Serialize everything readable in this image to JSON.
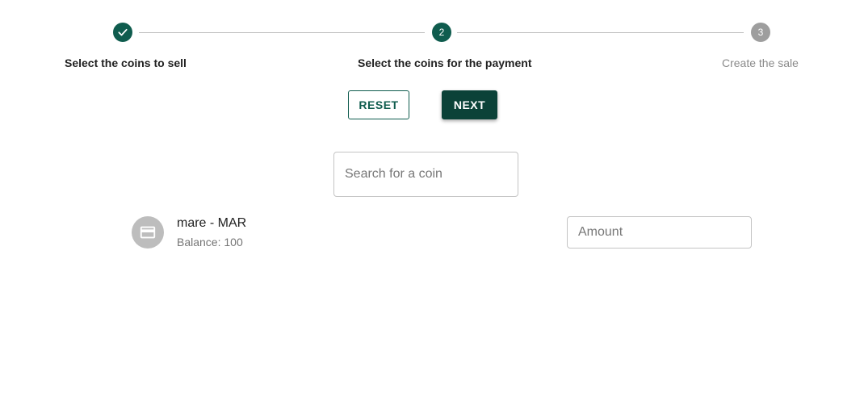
{
  "stepper": {
    "steps": [
      {
        "label": "Select the coins to sell",
        "state": "completed",
        "icon": "check-icon"
      },
      {
        "label": "Select the coins for the payment",
        "state": "active",
        "number": "2"
      },
      {
        "label": "Create the sale",
        "state": "pending",
        "number": "3"
      }
    ]
  },
  "actions": {
    "reset_label": "RESET",
    "next_label": "NEXT"
  },
  "search": {
    "placeholder": "Search for a coin",
    "value": ""
  },
  "coins": [
    {
      "name": "mare - MAR",
      "balance": "Balance: 100",
      "icon": "credit-card-icon",
      "amount_placeholder": "Amount",
      "amount_value": ""
    }
  ],
  "colors": {
    "primary": "#0f5c4e",
    "primary_dark": "#0b4238",
    "inactive": "#9e9e9e",
    "avatar_bg": "#bdbdbd"
  }
}
